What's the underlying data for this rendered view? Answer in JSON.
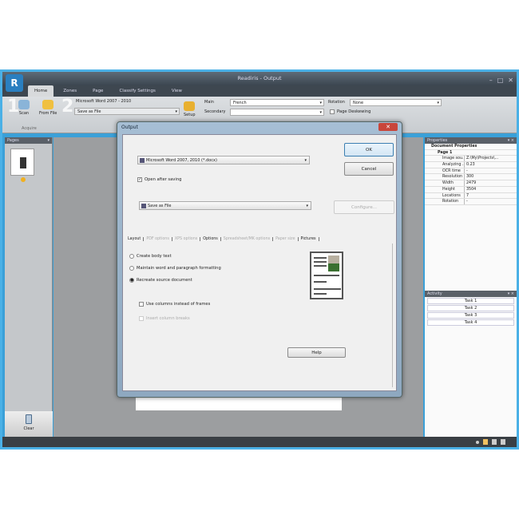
{
  "window": {
    "title": "Readiris - Output"
  },
  "tabs": [
    "Home",
    "Zones",
    "Page",
    "Classify Settings",
    "View"
  ],
  "ribbon": {
    "scan": "Scan",
    "from_file": "From File",
    "acquire_group": "Acquire",
    "format": "Microsoft Word 2007 - 2010",
    "destination": "Save as File",
    "setup": "Setup",
    "main_label": "Main",
    "main_value": "French",
    "secondary_label": "Secondary",
    "secondary_value": "",
    "rotation_label": "Rotation",
    "rotation_value": "None",
    "page_deskewing": "Page Deskewing"
  },
  "pages_panel": {
    "title": "Pages",
    "clear": "Clear"
  },
  "properties": {
    "title": "Properties",
    "rows": [
      {
        "k": "Document Properties",
        "v": ""
      },
      {
        "k": "Page 1",
        "v": ""
      },
      {
        "k": "Image sou...",
        "v": "Z:\\My\\Projects\\..."
      },
      {
        "k": "Analyzing ...",
        "v": "0.23"
      },
      {
        "k": "OCR time",
        "v": "-"
      },
      {
        "k": "Resolution",
        "v": "300"
      },
      {
        "k": "Width",
        "v": "2479"
      },
      {
        "k": "Height",
        "v": "3504"
      },
      {
        "k": "Locations",
        "v": "7"
      },
      {
        "k": "Rotation",
        "v": "-"
      }
    ]
  },
  "activity": {
    "title": "Activity",
    "tasks": [
      "Task 1",
      "Task 2",
      "Task 3",
      "Task 4"
    ]
  },
  "dialog": {
    "title": "Output",
    "format": "Microsoft Word 2007, 2010 (*.docx)",
    "open_after_saving": "Open after saving",
    "destination": "Save as File",
    "ok": "OK",
    "cancel": "Cancel",
    "configure": "Configure...",
    "tabs": [
      "Layout",
      "PDF options",
      "XPS options",
      "Options",
      "Spreadsheet/MK options",
      "Paper size",
      "Pictures"
    ],
    "radio_create_body": "Create body text",
    "radio_maintain": "Maintain word and paragraph formatting",
    "radio_recreate": "Recreate source document",
    "use_columns": "Use columns instead of frames",
    "insert_breaks": "Insert column breaks",
    "help": "Help"
  }
}
